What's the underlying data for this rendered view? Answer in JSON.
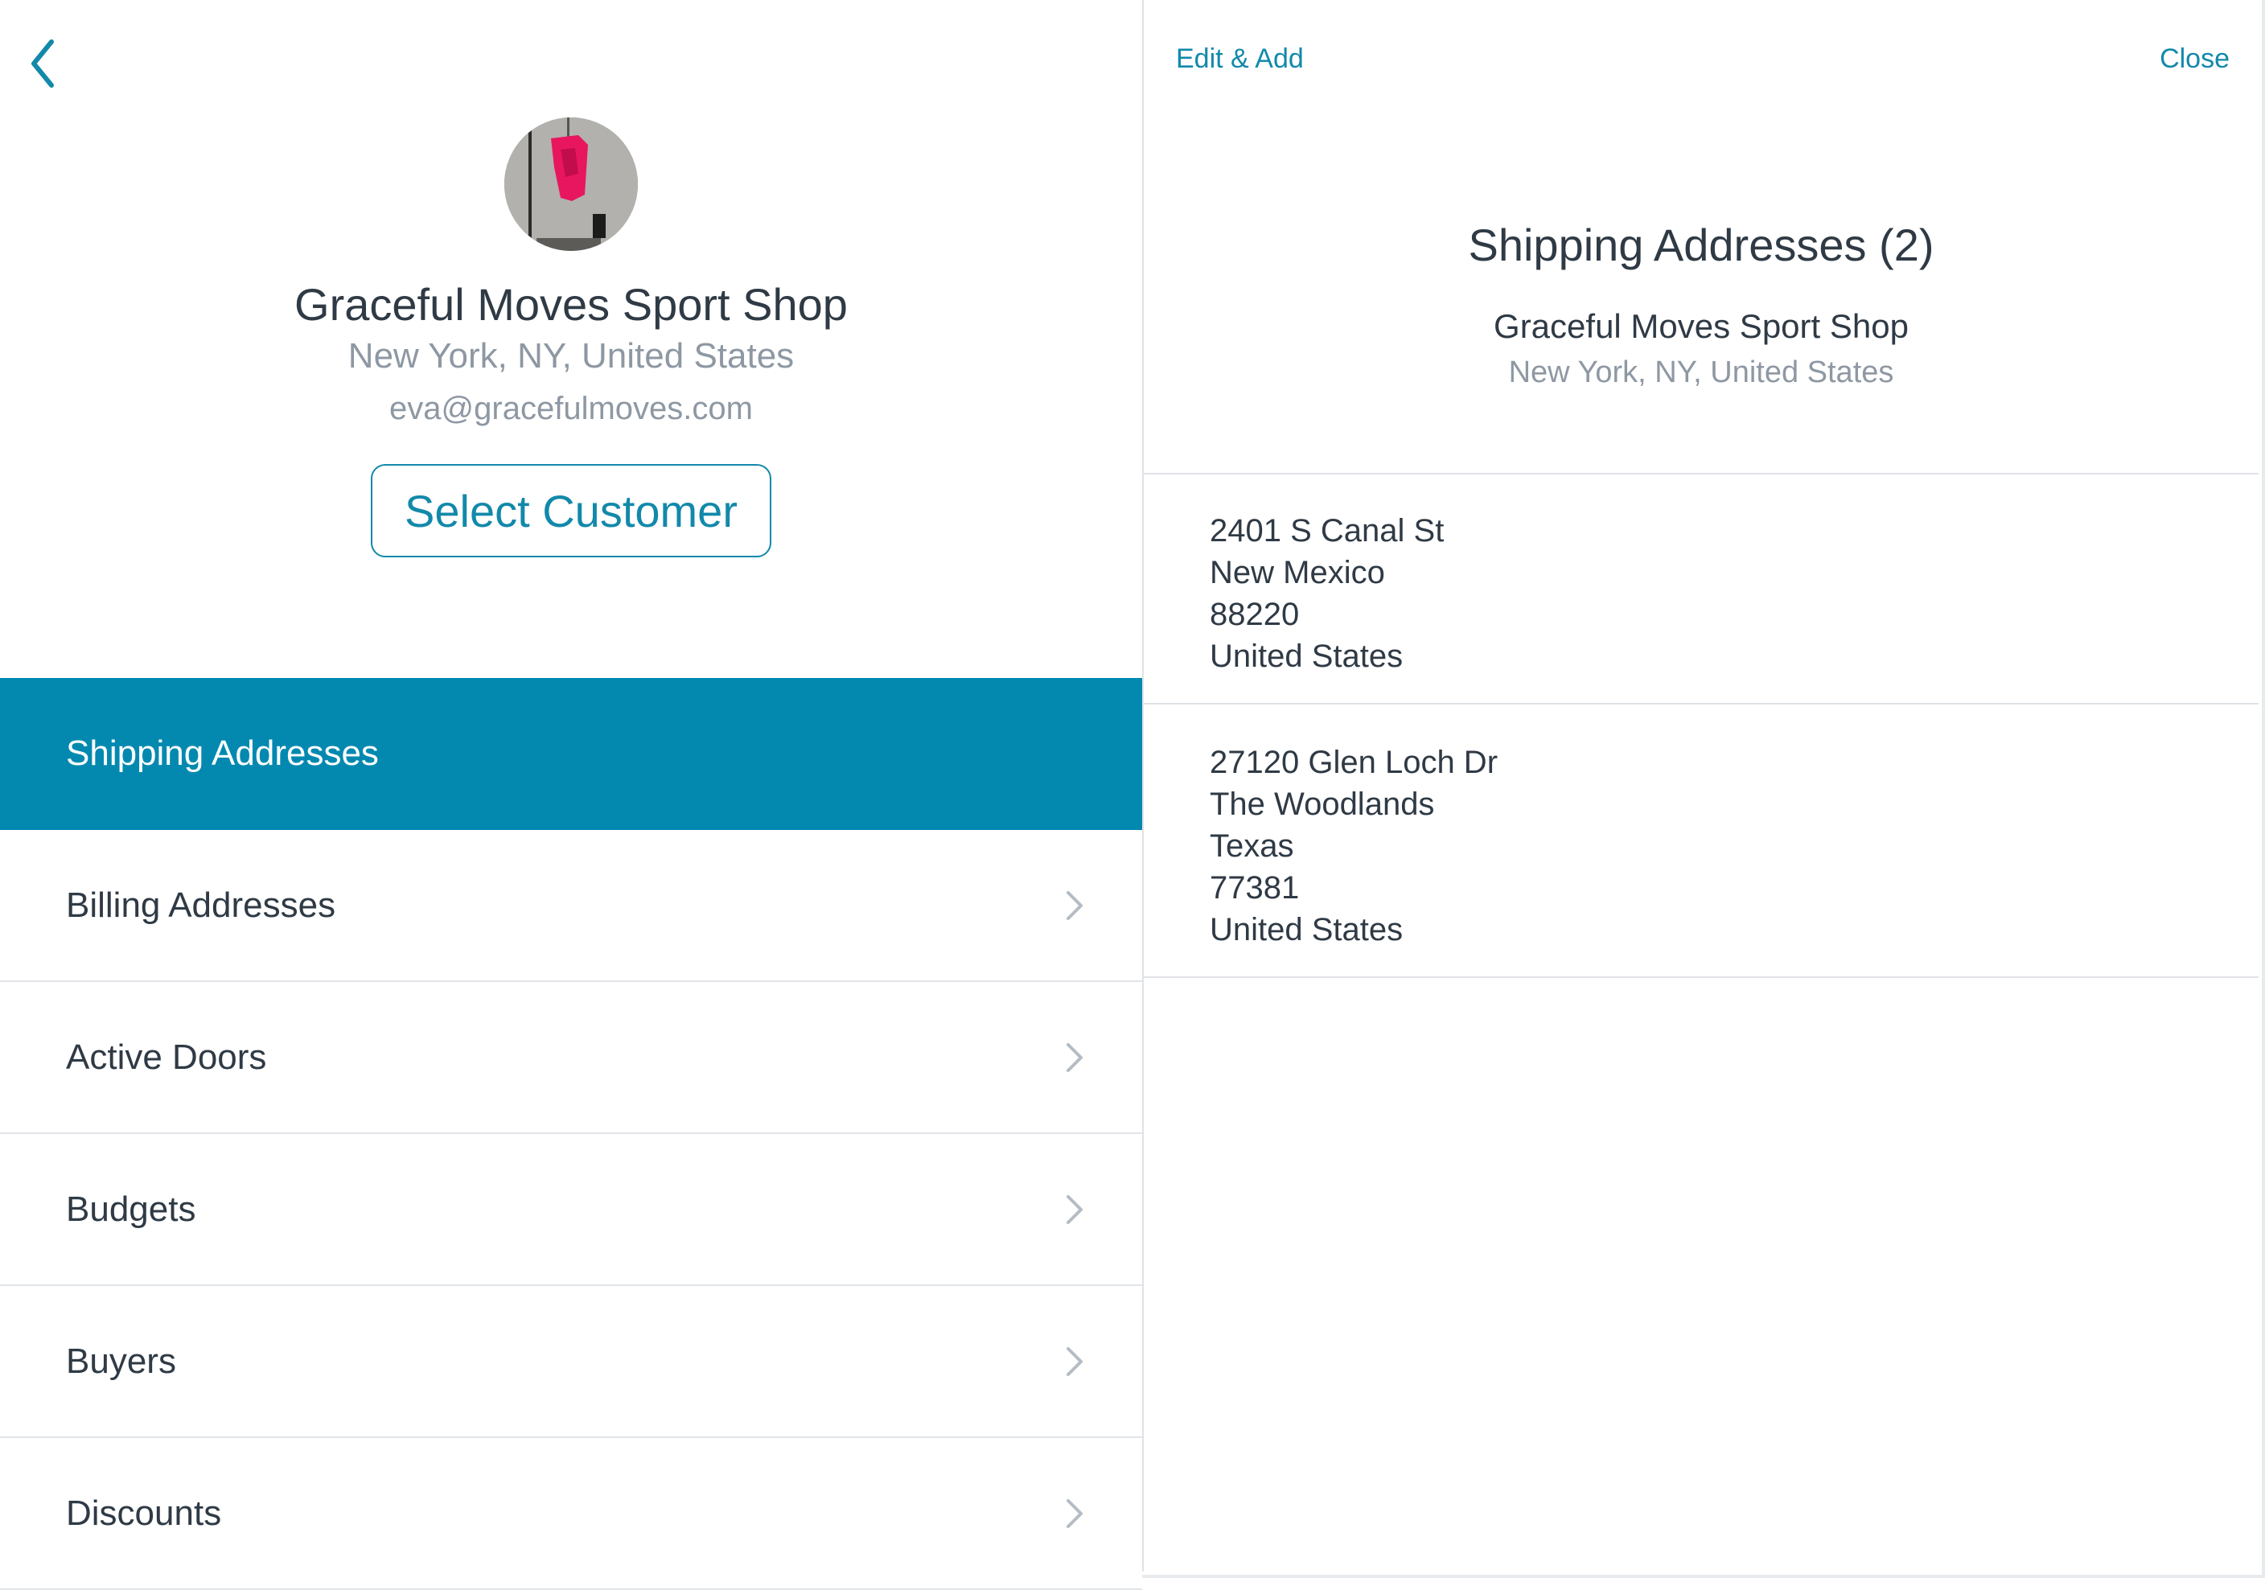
{
  "left_pane": {
    "customer": {
      "name": "Graceful Moves Sport Shop",
      "location": "New York, NY, United States",
      "email": "eva@gracefulmoves.com"
    },
    "select_button_label": "Select Customer",
    "menu": [
      {
        "label": "Shipping Addresses",
        "active": true
      },
      {
        "label": "Billing Addresses",
        "active": false
      },
      {
        "label": "Active Doors",
        "active": false
      },
      {
        "label": "Budgets",
        "active": false
      },
      {
        "label": "Buyers",
        "active": false
      },
      {
        "label": "Discounts",
        "active": false
      }
    ]
  },
  "right_pane": {
    "edit_label": "Edit & Add",
    "close_label": "Close",
    "title": "Shipping Addresses (2)",
    "customer_name": "Graceful Moves Sport Shop",
    "customer_location": "New York, NY, United States",
    "addresses": [
      [
        "2401 S Canal St",
        "New Mexico",
        "88220",
        "United States"
      ],
      [
        "27120 Glen Loch Dr",
        "The Woodlands",
        "Texas",
        "77381",
        "United States"
      ]
    ]
  },
  "colors": {
    "accent": "#0389b0",
    "link": "#1289aa",
    "text": "#2f3a45",
    "muted": "#8e98a3"
  },
  "icons": {
    "back": "chevron-left-icon",
    "row": "chevron-right-icon"
  }
}
